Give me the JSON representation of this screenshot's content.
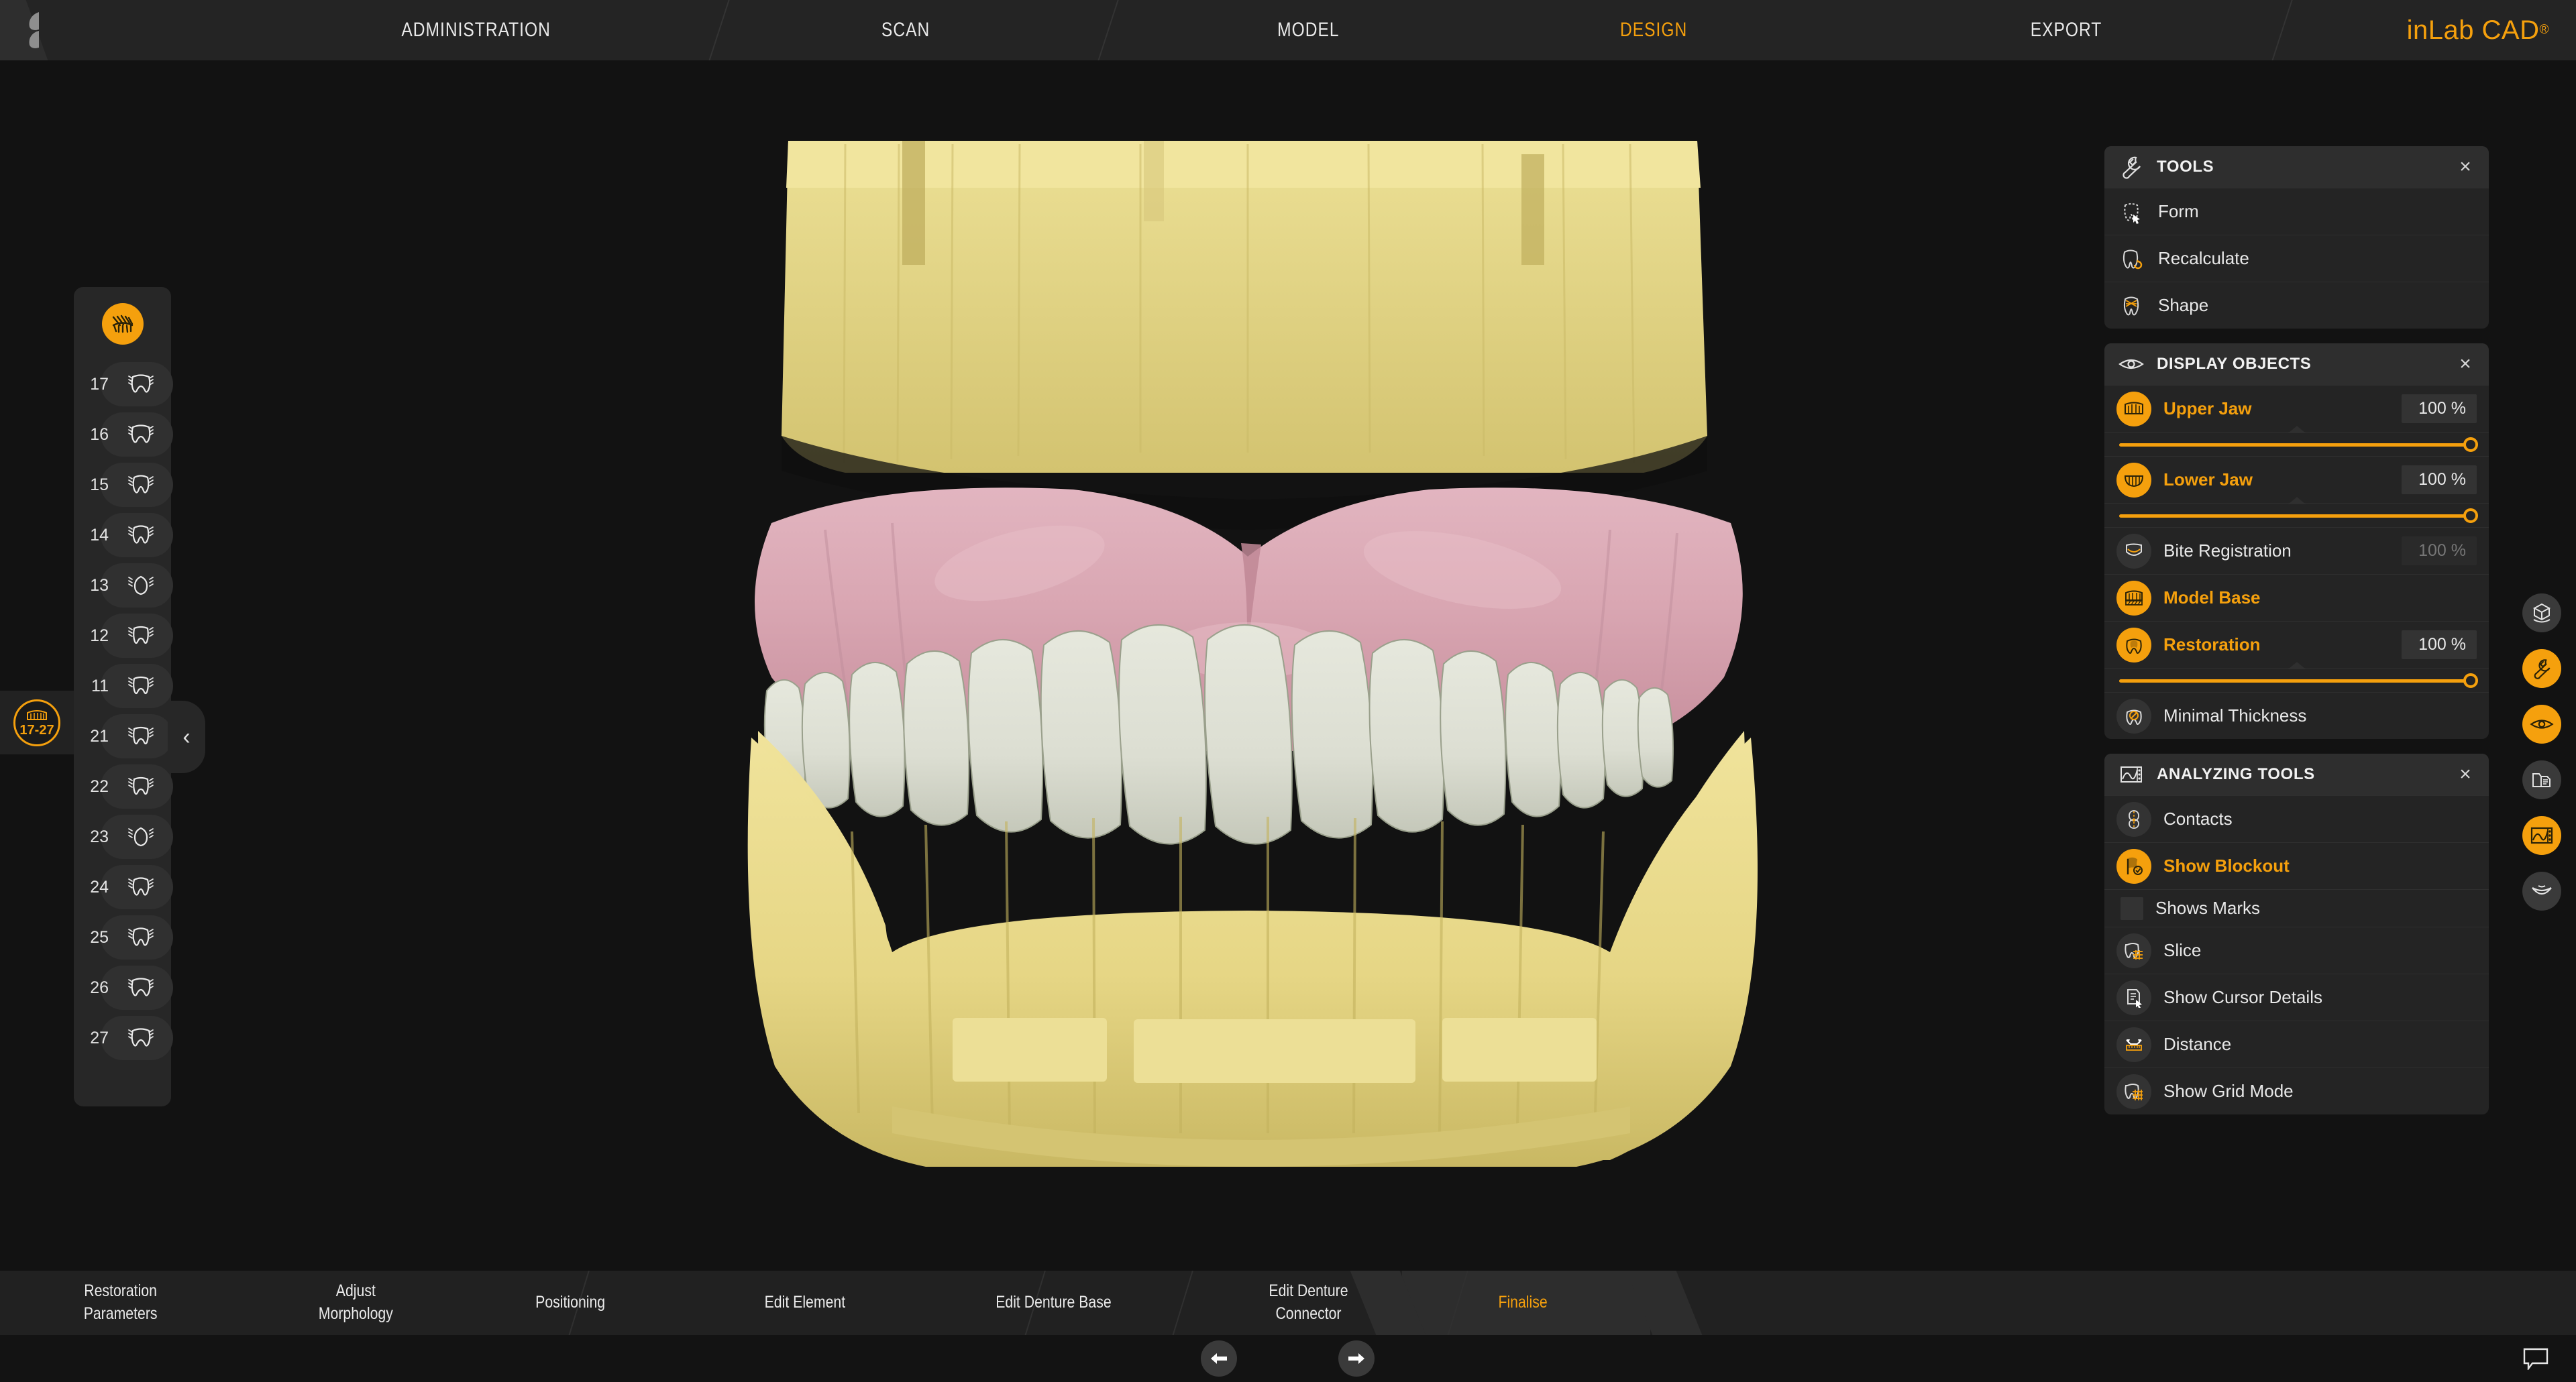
{
  "app": {
    "brand": "inLab CAD",
    "brand_sup": "®",
    "accent": "#f5a00d",
    "bg": "#121212"
  },
  "topnav": {
    "items": [
      {
        "label": "ADMINISTRATION",
        "active": false
      },
      {
        "label": "SCAN",
        "active": false
      },
      {
        "label": "MODEL",
        "active": false
      },
      {
        "label": "DESIGN",
        "active": true
      },
      {
        "label": "EXPORT",
        "active": false
      }
    ]
  },
  "tooth_panel": {
    "header_icon": "denture-arch-icon",
    "teeth": [
      {
        "number": "17",
        "glyph": "molar-icon"
      },
      {
        "number": "16",
        "glyph": "molar-icon"
      },
      {
        "number": "15",
        "glyph": "premolar-icon"
      },
      {
        "number": "14",
        "glyph": "premolar-icon"
      },
      {
        "number": "13",
        "glyph": "canine-icon"
      },
      {
        "number": "12",
        "glyph": "incisor-icon"
      },
      {
        "number": "11",
        "glyph": "incisor-icon"
      },
      {
        "number": "21",
        "glyph": "incisor-icon"
      },
      {
        "number": "22",
        "glyph": "incisor-icon"
      },
      {
        "number": "23",
        "glyph": "canine-icon"
      },
      {
        "number": "24",
        "glyph": "premolar-icon"
      },
      {
        "number": "25",
        "glyph": "premolar-icon"
      },
      {
        "number": "26",
        "glyph": "molar-icon"
      },
      {
        "number": "27",
        "glyph": "molar-icon"
      }
    ],
    "collapse_icon": "chevron-left-icon"
  },
  "jaw_badge": {
    "range": "17-27",
    "icon": "upper-denture-icon"
  },
  "panels": {
    "tools": {
      "title": "TOOLS",
      "icon": "wrench-icon",
      "close": "×",
      "items": [
        {
          "label": "Form",
          "icon": "tooth-cursor-icon",
          "highlight": false
        },
        {
          "label": "Recalculate",
          "icon": "tooth-recalc-icon",
          "highlight": false
        },
        {
          "label": "Shape",
          "icon": "tooth-shape-icon",
          "highlight": false
        }
      ]
    },
    "display_objects": {
      "title": "DISPLAY OBJECTS",
      "icon": "eye-icon",
      "close": "×",
      "items": [
        {
          "label": "Upper Jaw",
          "icon": "upper-jaw-icon",
          "value": "100 %",
          "active": true,
          "dim": false,
          "slider": true,
          "slider_pct": 100
        },
        {
          "label": "Lower Jaw",
          "icon": "lower-jaw-icon",
          "value": "100 %",
          "active": true,
          "dim": false,
          "slider": true,
          "slider_pct": 100
        },
        {
          "label": "Bite Registration",
          "icon": "bite-registration-icon",
          "value": "100 %",
          "active": false,
          "dim": true,
          "slider": false
        },
        {
          "label": "Model Base",
          "icon": "model-base-icon",
          "value": "",
          "active": true,
          "dim": false,
          "slider": false
        },
        {
          "label": "Restoration",
          "icon": "restoration-icon",
          "value": "100 %",
          "active": true,
          "dim": false,
          "slider": true,
          "slider_pct": 100
        },
        {
          "label": "Minimal Thickness",
          "icon": "minimal-thickness-icon",
          "value": "",
          "active": false,
          "dim": false,
          "slider": false
        }
      ]
    },
    "analyzing_tools": {
      "title": "ANALYZING TOOLS",
      "icon": "analysis-graph-icon",
      "close": "×",
      "items": [
        {
          "label": "Contacts",
          "icon": "contacts-icon",
          "active": false,
          "type": "icon"
        },
        {
          "label": "Show Blockout",
          "icon": "blockout-icon",
          "active": true,
          "type": "icon"
        },
        {
          "label": "Shows Marks",
          "icon": "checkbox",
          "active": false,
          "type": "checkbox"
        },
        {
          "label": "Slice",
          "icon": "slice-icon",
          "active": false,
          "type": "icon"
        },
        {
          "label": "Show Cursor Details",
          "icon": "cursor-details-icon",
          "active": false,
          "type": "icon"
        },
        {
          "label": "Distance",
          "icon": "ruler-icon",
          "active": false,
          "type": "icon"
        },
        {
          "label": "Show Grid Mode",
          "icon": "grid-mode-icon",
          "active": false,
          "type": "icon"
        }
      ]
    }
  },
  "edge_toolbar": {
    "items": [
      {
        "name": "view-cube-icon",
        "active": false
      },
      {
        "name": "wrench-icon",
        "active": true
      },
      {
        "name": "eye-icon",
        "active": true
      },
      {
        "name": "folder-document-icon",
        "active": false
      },
      {
        "name": "analysis-graph-icon",
        "active": true
      },
      {
        "name": "smile-jaw-icon",
        "active": false
      }
    ]
  },
  "stepbar": {
    "steps": [
      {
        "lines": [
          "Restoration",
          "Parameters"
        ],
        "active": false
      },
      {
        "lines": [
          "Adjust",
          "Morphology"
        ],
        "active": false
      },
      {
        "lines": [
          "Positioning"
        ],
        "active": false
      },
      {
        "lines": [
          "Edit Element"
        ],
        "active": false
      },
      {
        "lines": [
          "Edit Denture Base"
        ],
        "active": false
      },
      {
        "lines": [
          "Edit Denture",
          "Connector"
        ],
        "active": false
      },
      {
        "lines": [
          "Finalise"
        ],
        "active": true
      }
    ]
  },
  "bottombar": {
    "back_icon": "arrow-left-icon",
    "forward_icon": "arrow-right-icon",
    "chat_icon": "speech-bubble-icon"
  },
  "model": {
    "colors": {
      "model_base": "#e6d685",
      "gingiva": "#d9a6b2",
      "teeth": "#dcded2",
      "background": "#121212"
    }
  }
}
